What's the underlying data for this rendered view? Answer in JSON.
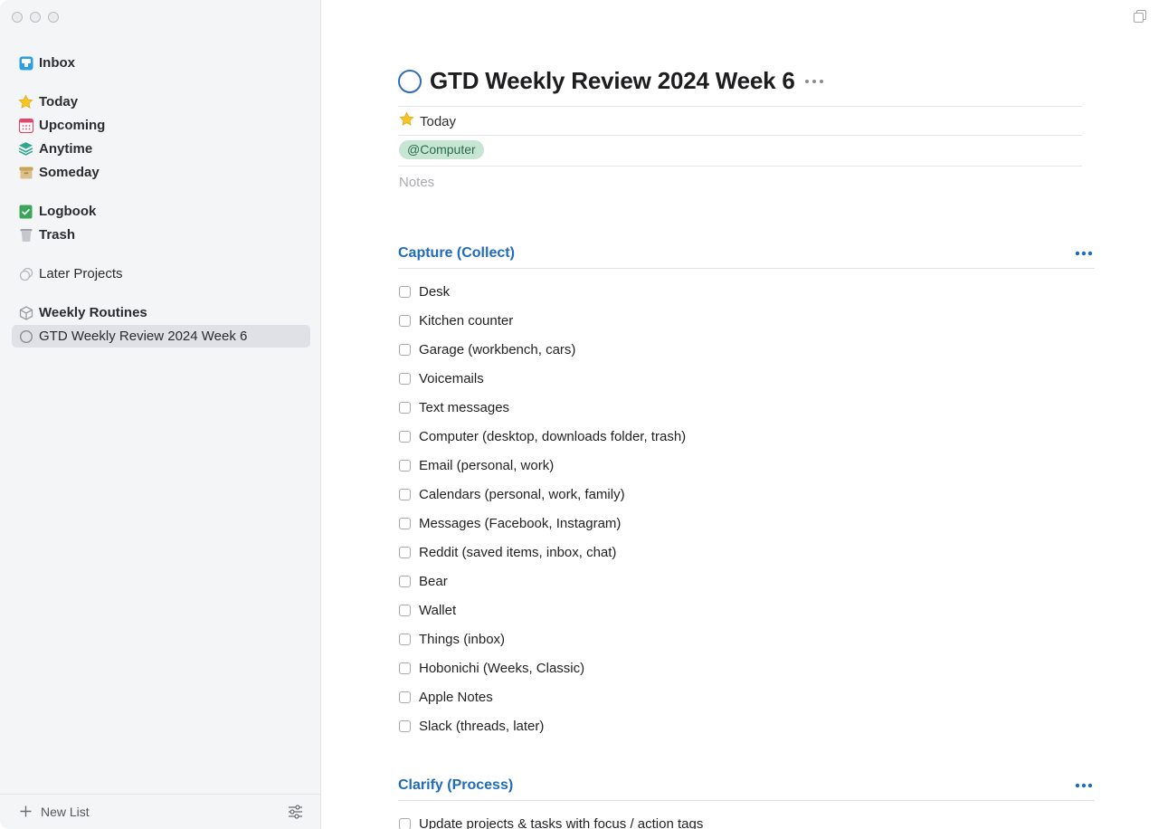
{
  "sidebar": {
    "items": [
      {
        "id": "inbox",
        "label": "Inbox",
        "icon": "inbox-icon"
      },
      {
        "id": "today",
        "label": "Today",
        "icon": "star-icon"
      },
      {
        "id": "upcoming",
        "label": "Upcoming",
        "icon": "calendar-icon"
      },
      {
        "id": "anytime",
        "label": "Anytime",
        "icon": "layers-icon"
      },
      {
        "id": "someday",
        "label": "Someday",
        "icon": "archive-box-icon"
      },
      {
        "id": "logbook",
        "label": "Logbook",
        "icon": "logbook-check-icon"
      },
      {
        "id": "trash",
        "label": "Trash",
        "icon": "trash-icon"
      },
      {
        "id": "later-projects",
        "label": "Later Projects",
        "icon": "later-projects-icon"
      },
      {
        "id": "weekly-routines",
        "label": "Weekly Routines",
        "icon": "area-cube-icon"
      },
      {
        "id": "gtd-review",
        "label": "GTD Weekly Review 2024 Week 6",
        "icon": "project-circle-icon",
        "selected": true
      }
    ],
    "new_list_label": "New List"
  },
  "task": {
    "title": "GTD Weekly Review 2024 Week 6",
    "when": "Today",
    "tag": "@Computer",
    "notes_placeholder": "Notes"
  },
  "sections": [
    {
      "heading": "Capture (Collect)",
      "items": [
        "Desk",
        "Kitchen counter",
        "Garage (workbench, cars)",
        "Voicemails",
        "Text messages",
        "Computer (desktop, downloads folder, trash)",
        "Email (personal, work)",
        "Calendars (personal, work, family)",
        "Messages (Facebook, Instagram)",
        "Reddit (saved items, inbox, chat)",
        "Bear",
        "Wallet",
        "Things (inbox)",
        "Hobonichi (Weeks, Classic)",
        "Apple Notes",
        "Slack (threads, later)"
      ]
    },
    {
      "heading": "Clarify (Process)",
      "items": [
        "Update projects & tasks with focus / action tags"
      ]
    }
  ],
  "colors": {
    "accent": "#1f6bbd",
    "project_ring": "#2f6db8",
    "tag_bg": "#c6e6d3",
    "tag_text": "#2d6a4a",
    "sidebar_bg": "#f4f5f7",
    "selected_bg": "#dfe1e6"
  }
}
